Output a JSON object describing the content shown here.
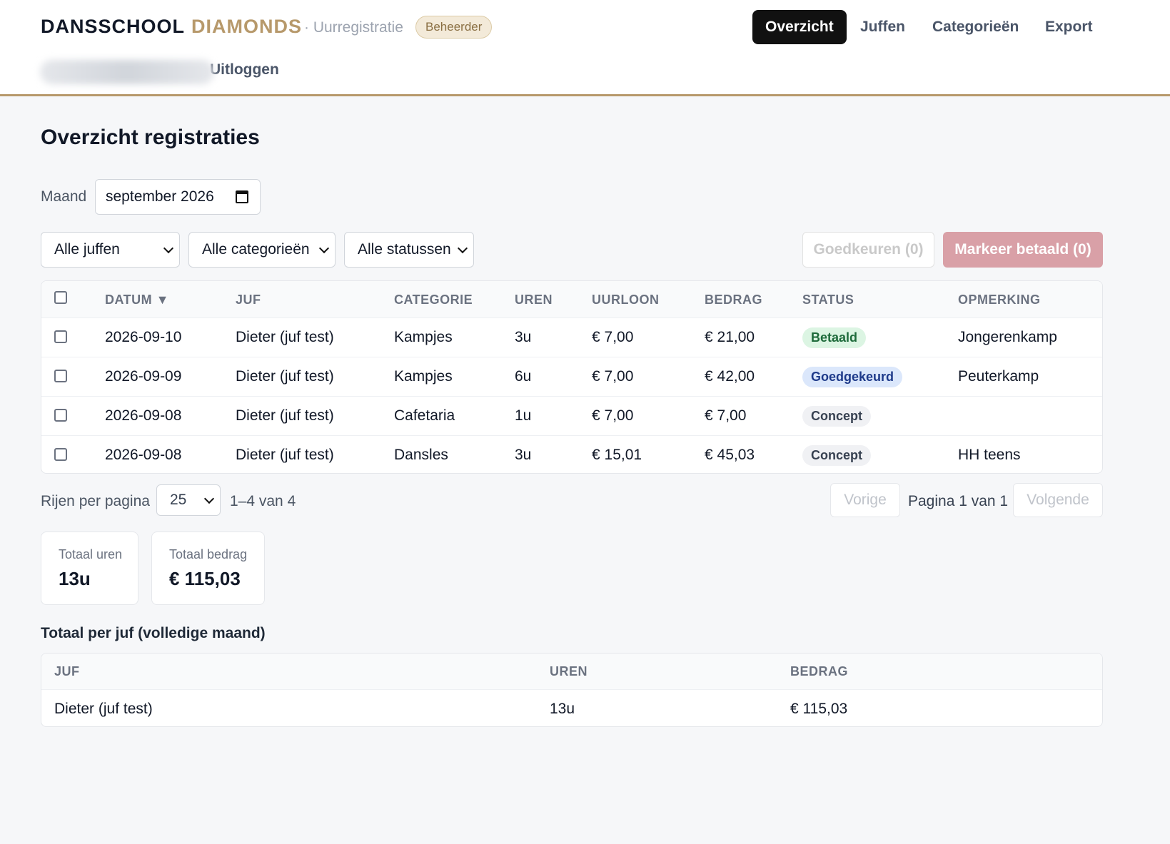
{
  "header": {
    "brand_part1": "DANSSCHOOL",
    "brand_part2": "DIAMONDS",
    "subtitle": "· Uurregistratie",
    "role_badge": "Beheerder",
    "nav": [
      "Overzicht",
      "Juffen",
      "Categorieën",
      "Export"
    ],
    "active_nav": "Overzicht",
    "logout": "Uitloggen"
  },
  "page": {
    "title": "Overzicht registraties"
  },
  "filters": {
    "month_label": "Maand",
    "month_value": "september 2026",
    "teacher": "Alle juffen",
    "category": "Alle categorieën",
    "status": "Alle statussen"
  },
  "actions": {
    "approve": "Goedkeuren (0)",
    "mark_paid": "Markeer betaald (0)"
  },
  "table": {
    "columns": [
      "DATUM ▼",
      "JUF",
      "CATEGORIE",
      "UREN",
      "UURLOON",
      "BEDRAG",
      "STATUS",
      "OPMERKING"
    ],
    "rows": [
      {
        "date": "2026-09-10",
        "teacher": "Dieter (juf test)",
        "category": "Kampjes",
        "hours": "3u",
        "rate": "€ 7,00",
        "amount": "€ 21,00",
        "status": "Betaald",
        "note": "Jongerenkamp"
      },
      {
        "date": "2026-09-09",
        "teacher": "Dieter (juf test)",
        "category": "Kampjes",
        "hours": "6u",
        "rate": "€ 7,00",
        "amount": "€ 42,00",
        "status": "Goedgekeurd",
        "note": "Peuterkamp"
      },
      {
        "date": "2026-09-08",
        "teacher": "Dieter (juf test)",
        "category": "Cafetaria",
        "hours": "1u",
        "rate": "€ 7,00",
        "amount": "€ 7,00",
        "status": "Concept",
        "note": ""
      },
      {
        "date": "2026-09-08",
        "teacher": "Dieter (juf test)",
        "category": "Dansles",
        "hours": "3u",
        "rate": "€ 15,01",
        "amount": "€ 45,03",
        "status": "Concept",
        "note": "HH teens"
      }
    ]
  },
  "pagination": {
    "rows_label": "Rijen per pagina",
    "rows_value": "25",
    "range": "1–4 van 4",
    "prev": "Vorige",
    "page_text": "Pagina 1 van 1",
    "next": "Volgende"
  },
  "totals": {
    "hours_label": "Totaal uren",
    "hours_value": "13u",
    "amount_label": "Totaal bedrag",
    "amount_value": "€ 115,03"
  },
  "per_teacher": {
    "title": "Totaal per juf (volledige maand)",
    "columns": [
      "JUF",
      "UREN",
      "BEDRAG"
    ],
    "rows": [
      {
        "teacher": "Dieter (juf test)",
        "hours": "13u",
        "amount": "€ 115,03"
      }
    ]
  },
  "colors": {
    "accent": "#b7996b",
    "nav_active_bg": "#111111",
    "paid_button": "#d9a0a7"
  },
  "icons": {
    "month_input": "calendar-icon",
    "select": "chevron-down-icon",
    "sort": "sort-desc-icon"
  }
}
